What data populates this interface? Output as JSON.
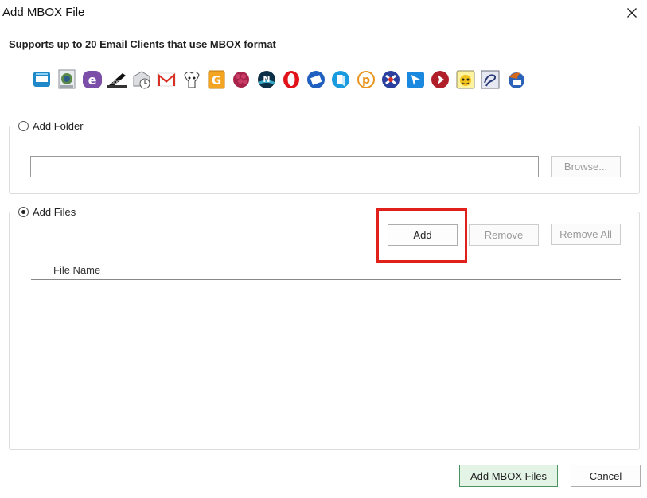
{
  "window": {
    "title": "Add MBOX File"
  },
  "header": {
    "subtitle": "Supports up to 20 Email Clients that use MBOX format"
  },
  "client_icons": [
    "window-mail-icon",
    "mail-stamp-icon",
    "entourage-icon",
    "eudora-icon",
    "postbox-icon",
    "gmail-icon",
    "gnu-icon",
    "g-mail-icon",
    "seamonkey-icon",
    "netscape-icon",
    "opera-icon",
    "pocomail-icon",
    "spicebird-icon",
    "powermail-icon",
    "mulberry-icon",
    "sylpheed-icon",
    "cone-icon",
    "claws-icon",
    "evolution-icon",
    "thunderbird-icon"
  ],
  "add_folder": {
    "label": "Add Folder",
    "selected": false,
    "path_value": "",
    "browse_label": "Browse..."
  },
  "add_files": {
    "label": "Add Files",
    "selected": true,
    "add_label": "Add",
    "remove_label": "Remove",
    "remove_all_label": "Remove All",
    "column_header": "File Name",
    "files": []
  },
  "footer": {
    "primary_label": "Add MBOX Files",
    "cancel_label": "Cancel"
  },
  "colors": {
    "highlight": "#e0201b",
    "primary_bg": "#e3f4e7",
    "primary_border": "#4a9460"
  }
}
